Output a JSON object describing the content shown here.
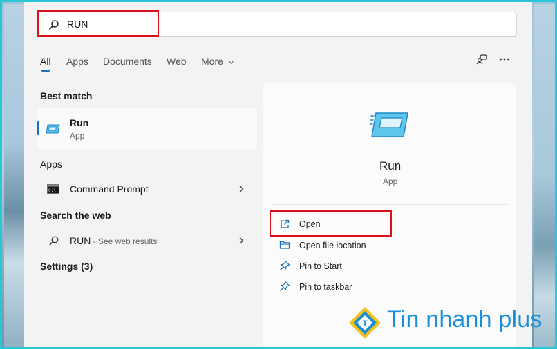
{
  "search": {
    "query": "RUN"
  },
  "tabs": [
    {
      "label": "All",
      "active": true
    },
    {
      "label": "Apps"
    },
    {
      "label": "Documents"
    },
    {
      "label": "Web"
    },
    {
      "label": "More"
    }
  ],
  "top_icons": [
    "account-switch-icon",
    "more-options-icon"
  ],
  "results": {
    "best_match_heading": "Best match",
    "best_match": {
      "title": "Run",
      "subtitle": "App"
    },
    "apps_heading": "Apps",
    "apps": [
      {
        "title": "Command Prompt"
      }
    ],
    "web_heading": "Search the web",
    "web_item": {
      "title": "RUN",
      "suffix": " - See web results"
    },
    "settings_heading": "Settings (3)"
  },
  "detail": {
    "title": "Run",
    "subtitle": "App",
    "actions": [
      {
        "label": "Open",
        "icon": "open-external-icon"
      },
      {
        "label": "Open file location",
        "icon": "folder-icon"
      },
      {
        "label": "Pin to Start",
        "icon": "pin-icon"
      },
      {
        "label": "Pin to taskbar",
        "icon": "pin-icon"
      }
    ]
  },
  "watermark": {
    "text": "Tin nhanh plus",
    "logo_letter": "T"
  },
  "colors": {
    "accent": "#1a6fb8",
    "highlight": "#d8101a",
    "frame": "#29c7d6",
    "logo": "#1a8fd6"
  }
}
